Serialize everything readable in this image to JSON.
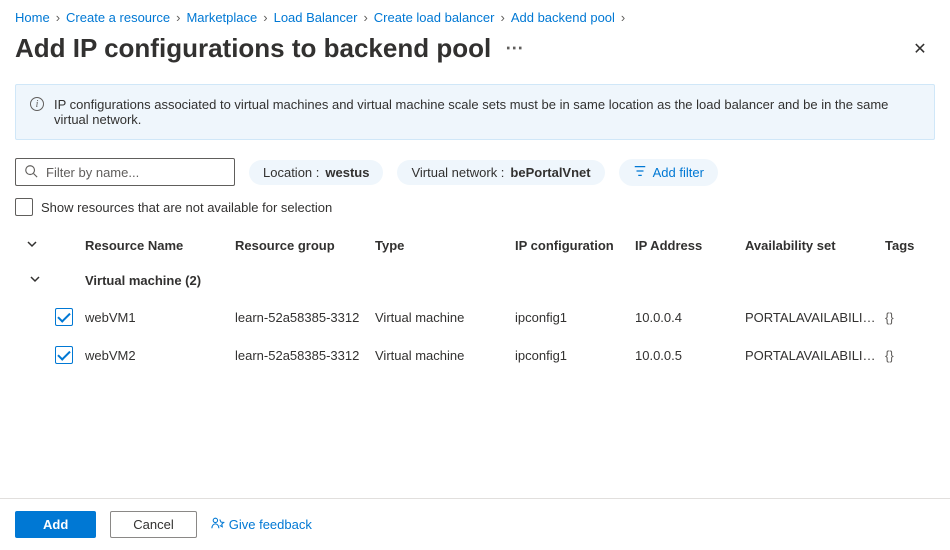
{
  "breadcrumb": [
    "Home",
    "Create a resource",
    "Marketplace",
    "Load Balancer",
    "Create load balancer",
    "Add backend pool"
  ],
  "page_title": "Add IP configurations to backend pool",
  "info_message": "IP configurations associated to virtual machines and virtual machine scale sets must be in same location as the load balancer and be in the same virtual network.",
  "search": {
    "placeholder": "Filter by name..."
  },
  "filters": {
    "location": {
      "label": "Location :",
      "value": "westus"
    },
    "vnet": {
      "label": "Virtual network :",
      "value": "bePortalVnet"
    },
    "add_filter_label": "Add filter"
  },
  "show_unavailable_label": "Show resources that are not available for selection",
  "columns": {
    "resource_name": "Resource Name",
    "resource_group": "Resource group",
    "type": "Type",
    "ip_config": "IP configuration",
    "ip_address": "IP Address",
    "availability_set": "Availability set",
    "tags": "Tags"
  },
  "group": {
    "label": "Virtual machine (2)"
  },
  "rows": [
    {
      "selected": true,
      "name": "webVM1",
      "rg": "learn-52a58385-3312",
      "type": "Virtual machine",
      "ipconfig": "ipconfig1",
      "ip": "10.0.0.4",
      "avset": "PORTALAVAILABILITY",
      "tags": "{}"
    },
    {
      "selected": true,
      "name": "webVM2",
      "rg": "learn-52a58385-3312",
      "type": "Virtual machine",
      "ipconfig": "ipconfig1",
      "ip": "10.0.0.5",
      "avset": "PORTALAVAILABILITY",
      "tags": "{}"
    }
  ],
  "footer": {
    "add": "Add",
    "cancel": "Cancel",
    "feedback": "Give feedback"
  }
}
